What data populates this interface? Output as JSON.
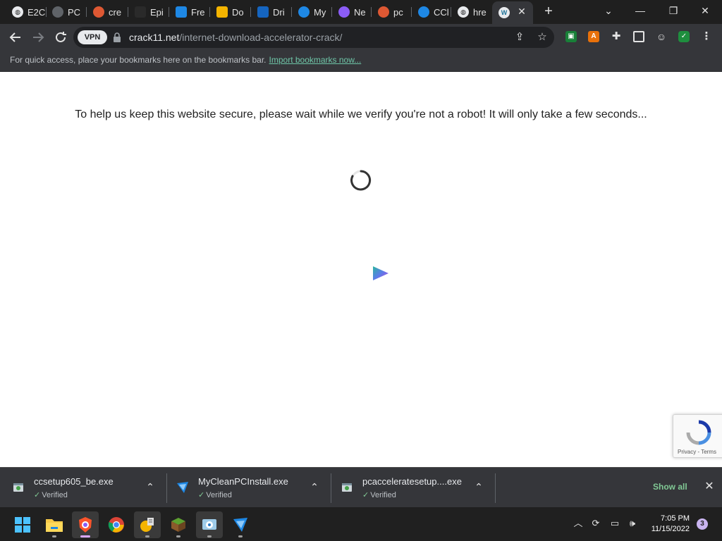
{
  "window_controls": {
    "search_tabs": "⌄",
    "minimize": "—",
    "restore": "❐",
    "close": "✕"
  },
  "tabs": [
    {
      "title": "E2C",
      "icon": "globe-icon",
      "color": "#e8eaed"
    },
    {
      "title": "PC",
      "icon": "pc-icon",
      "color": "#5f6368"
    },
    {
      "title": "cre",
      "icon": "duckduckgo-icon",
      "color": "#de5833"
    },
    {
      "title": "Epi",
      "icon": "epic-icon",
      "color": "#2a2a2a"
    },
    {
      "title": "Fre",
      "icon": "fre-icon",
      "color": "#1e88e5"
    },
    {
      "title": "Do",
      "icon": "download-icon",
      "color": "#f4b400"
    },
    {
      "title": "Dri",
      "icon": "driver-icon",
      "color": "#1565c0"
    },
    {
      "title": "My",
      "icon": "myclean-icon",
      "color": "#1e88e5"
    },
    {
      "title": "Ne",
      "icon": "brave-icon",
      "color": "#8b5cf6"
    },
    {
      "title": "pc",
      "icon": "duckduckgo-icon",
      "color": "#de5833"
    },
    {
      "title": "CCl",
      "icon": "ccleaner-icon",
      "color": "#1e88e5"
    },
    {
      "title": "hre",
      "icon": "globe-icon",
      "color": "#e8eaed"
    },
    {
      "title": "",
      "icon": "wordpress-icon",
      "color": "#21759b",
      "active": true
    }
  ],
  "omnibox": {
    "vpn_label": "VPN",
    "host": "crack11.net",
    "path": "/internet-download-accelerator-crack/"
  },
  "bookmarks_bar": {
    "hint": "For quick access, place your bookmarks here on the bookmarks bar.",
    "import_link": "Import bookmarks now..."
  },
  "page": {
    "message": "To help us keep this website secure, please wait while we verify you're not a robot! It will only take a few seconds...",
    "recaptcha_terms": "Privacy - Terms"
  },
  "downloads": [
    {
      "filename": "ccsetup605_be.exe",
      "status": "Verified",
      "icon": "installer-icon"
    },
    {
      "filename": "MyCleanPCInstall.exe",
      "status": "Verified",
      "icon": "myclean-icon"
    },
    {
      "filename": "pcacceleratesetup....exe",
      "status": "Verified",
      "icon": "installer-icon"
    }
  ],
  "download_shelf": {
    "show_all": "Show all",
    "close": "✕"
  },
  "taskbar": {
    "apps": [
      "start-icon",
      "file-explorer-icon",
      "brave-icon",
      "chrome-icon",
      "cleaner-icon",
      "minecraft-icon",
      "installer-icon",
      "myclean-icon"
    ],
    "time": "7:05 PM",
    "date": "11/15/2022",
    "notification_count": "3"
  }
}
